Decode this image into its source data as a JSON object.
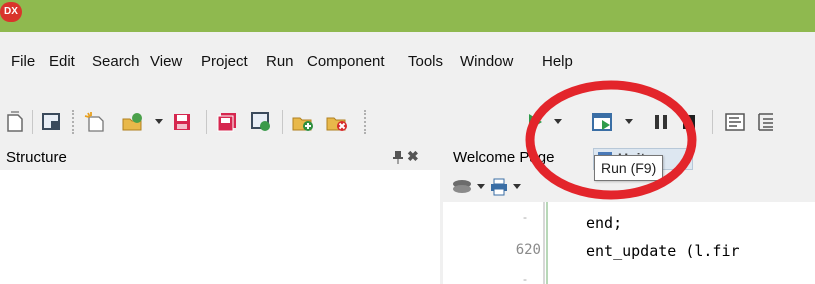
{
  "app": {
    "icon_label": "DX",
    "accent_color": "#8fb94f"
  },
  "menu": {
    "items": [
      "File",
      "Edit",
      "Search",
      "View",
      "Project",
      "Run",
      "Component",
      "Tools",
      "Window",
      "Help"
    ]
  },
  "toolbar": {
    "icons": [
      "new-items-icon",
      "view-form-icon",
      "new-icon",
      "open-icon",
      "save-icon",
      "save-all-icon",
      "open-project-icon",
      "add-to-project-icon",
      "remove-from-project-icon",
      "run-without-debugging-icon",
      "run-icon",
      "pause-icon",
      "stop-icon",
      "trace-into-icon",
      "step-over-icon"
    ]
  },
  "tooltip": {
    "text": "Run (F9)"
  },
  "structure_panel": {
    "title": "Structure"
  },
  "editor": {
    "tabs": [
      "Welcome Page",
      "Unit"
    ],
    "lines": [
      {
        "number": "-",
        "code": "end;"
      },
      {
        "number": "620",
        "code": "ent_update (l.fir"
      },
      {
        "number": "-",
        "code": ""
      }
    ]
  },
  "annotation": {
    "color": "#e3252b"
  }
}
